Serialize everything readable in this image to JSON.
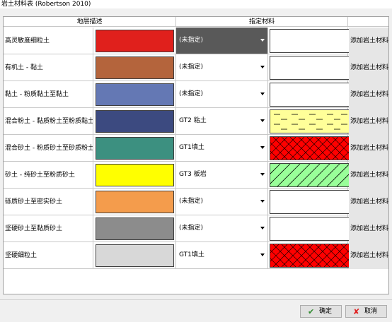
{
  "window": {
    "title": "岩土材料表 (Robertson 2010)"
  },
  "table": {
    "header_left": "地层描述",
    "header_right": "指定材料",
    "rows": [
      {
        "desc": "高灵敏度细粒土",
        "color": "#e0201c",
        "combo": "(未指定)",
        "material": "",
        "pattern": "none",
        "add": "添加岩土材料"
      },
      {
        "desc": "有机土 - 黏土",
        "color": "#b4643c",
        "combo": "(未指定)",
        "material": "",
        "pattern": "none",
        "add": "添加岩土材料"
      },
      {
        "desc": "黏土 - 粉质黏土至黏土",
        "color": "#6478b4",
        "combo": "(未指定)",
        "material": "",
        "pattern": "none",
        "add": "添加岩土材料"
      },
      {
        "desc": "混合粉土 - 黏质粉土至粉质黏土",
        "color": "#3c4a80",
        "combo": "GT2 粘土",
        "material": "GT2 粘土",
        "pattern": "clay",
        "add": "添加岩土材料"
      },
      {
        "desc": "混合砂土 - 粉质砂土至砂质粉土",
        "color": "#3c9080",
        "combo": "GT1填土",
        "material": "GT1填土",
        "pattern": "fill",
        "add": "添加岩土材料"
      },
      {
        "desc": "砂土 - 纯砂土至粉质砂土",
        "color": "#ffff00",
        "combo": "GT3 板岩",
        "material": "GT3 板岩",
        "pattern": "slate",
        "add": "添加岩土材料"
      },
      {
        "desc": "砾质砂土至密实砂土",
        "color": "#f49c4c",
        "combo": "(未指定)",
        "material": "",
        "pattern": "none",
        "add": "添加岩土材料"
      },
      {
        "desc": "坚硬砂土至黏质砂土",
        "color": "#8c8c8c",
        "combo": "(未指定)",
        "material": "",
        "pattern": "none",
        "add": "添加岩土材料"
      },
      {
        "desc": "坚硬细粒土",
        "color": "#d8d8d8",
        "combo": "GT1填土",
        "material": "GT1填土",
        "pattern": "fill",
        "add": "添加岩土材料"
      }
    ]
  },
  "buttons": {
    "ok": "确定",
    "cancel": "取消"
  },
  "icons": {
    "ok": "checkmark-icon",
    "cancel": "x-icon",
    "dropdown": "chevron-down-icon"
  },
  "colors": {
    "active_combo": "#595959",
    "clay_fill": "#ffff99",
    "fill_red": "#ff0000",
    "slate_fill": "#99ff99"
  }
}
